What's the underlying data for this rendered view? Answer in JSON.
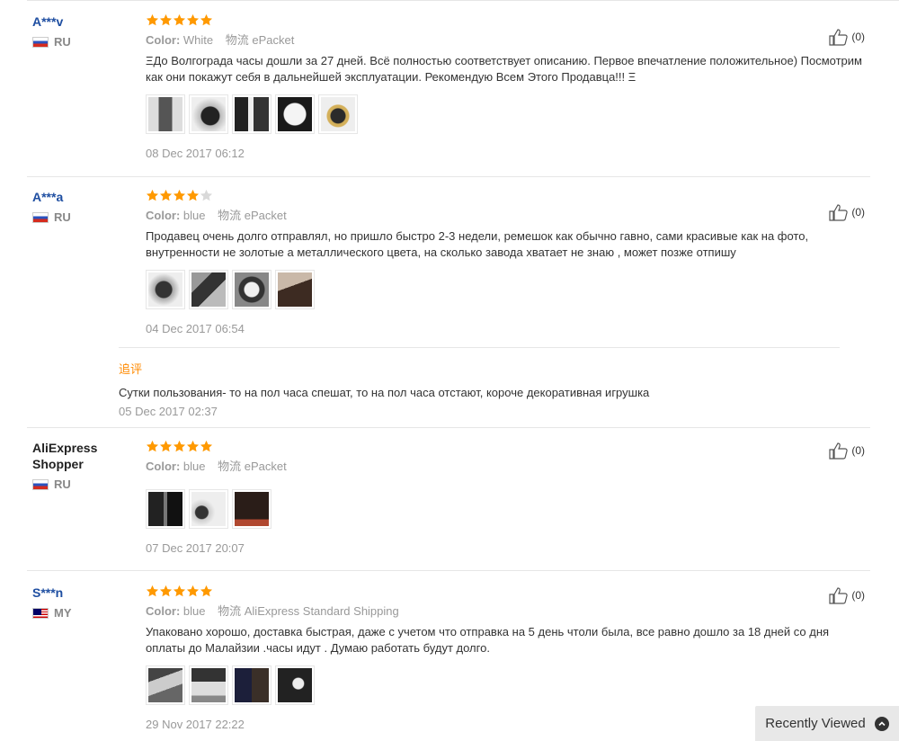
{
  "reviews": [
    {
      "user": "A***v",
      "country": "RU",
      "stars": 5,
      "color_label": "Color:",
      "color_value": "White",
      "ship_label": "物流",
      "ship_value": "ePacket",
      "text": "ΞДо Волгограда часы дошли за 27 дней. Всё полностью соответствует описанию. Первое впечатление положительное) Посмотрим как они покажут себя в дальнейшей эксплуатации. Рекомендую Всем Этого Продавца!!! Ξ",
      "date": "08 Dec 2017 06:12",
      "likes": "(0)"
    },
    {
      "user": "A***a",
      "country": "RU",
      "stars": 4,
      "color_label": "Color:",
      "color_value": "blue",
      "ship_label": "物流",
      "ship_value": "ePacket",
      "text": "Продавец очень долго отправлял, но пришло быстро 2-3 недели, ремешок как обычно гавно, сами красивые как на фото, внутренности не золотые а металлического цвета, на сколько завода хватает не знаю , может позже отпишу",
      "date": "04 Dec 2017 06:54",
      "likes": "(0)",
      "additional": {
        "label": "追评",
        "text": "Сутки пользования- то на пол часа спешат, то на пол часа отстают, короче декоративная игрушка",
        "date": "05 Dec 2017 02:37"
      }
    },
    {
      "user": "AliExpress Shopper",
      "country": "RU",
      "stars": 5,
      "color_label": "Color:",
      "color_value": "blue",
      "ship_label": "物流",
      "ship_value": "ePacket",
      "text": "",
      "date": "07 Dec 2017 20:07",
      "likes": "(0)"
    },
    {
      "user": "S***n",
      "country": "MY",
      "stars": 5,
      "color_label": "Color:",
      "color_value": "blue",
      "ship_label": "物流",
      "ship_value": "AliExpress Standard Shipping",
      "text": "Упаковано хорошо, доставка быстрая, даже с учетом что отправка на 5 день чтоли была, все равно дошло за 18 дней со дня оплаты до Малайзии .часы идут . Думаю работать будут долго.",
      "date": "29 Nov 2017 22:22",
      "likes": "(0)"
    }
  ],
  "recently_viewed": "Recently Viewed",
  "colors": {
    "star": "#ff9900",
    "star_empty": "#d9d9d9",
    "username": "#1e4ea1",
    "additional_label": "#ff8a00"
  }
}
